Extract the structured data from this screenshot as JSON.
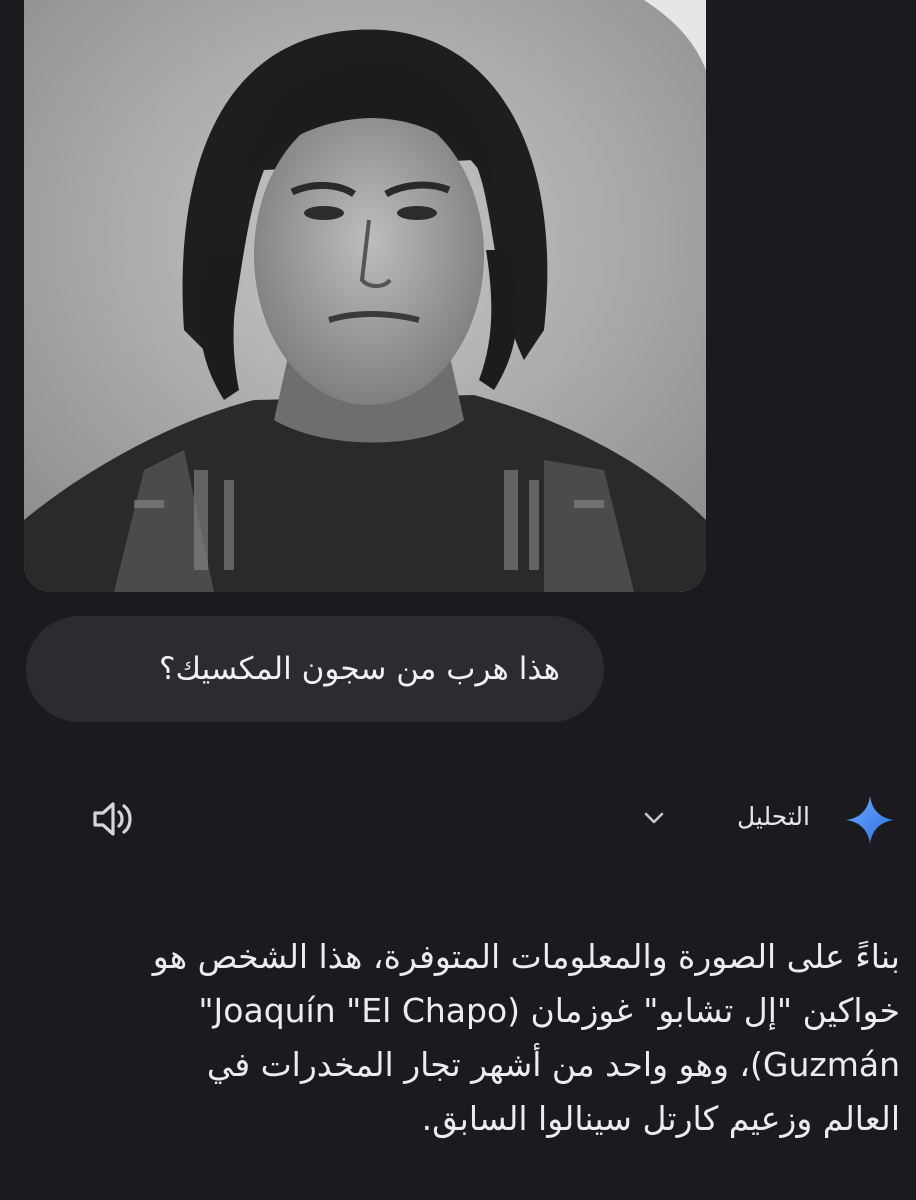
{
  "chat": {
    "user_message": "هذا هرب من سجون المكسيك؟",
    "analysis_label": "التحليل",
    "response_lines": [
      "بناءً على الصورة والمعلومات المتوفرة، هذا الشخص هو",
      "خواكين \"إل تشابو\" غوزمان (Joaquín \"El Chapo\"",
      "Guzmán)، وهو واحد من أشهر تجار المخدرات في",
      "العالم وزعيم كارتل سينالوا السابق."
    ]
  },
  "icons": {
    "expand": "chevron-down-icon",
    "audio": "speaker-icon",
    "assistant": "sparkle-icon",
    "accent": "#4b8ff5"
  }
}
